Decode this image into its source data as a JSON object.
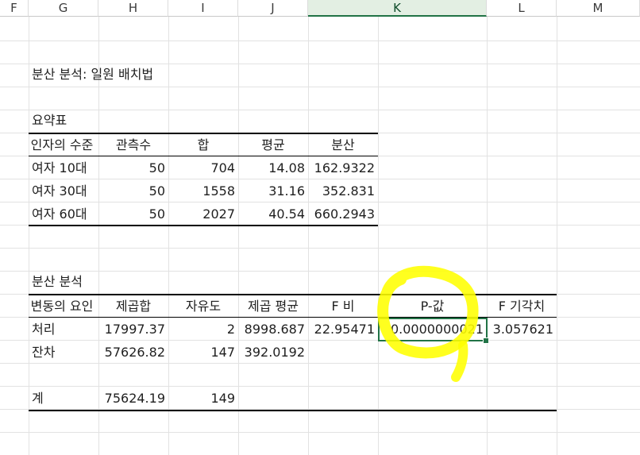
{
  "columns": [
    "F",
    "G",
    "H",
    "I",
    "J",
    "K",
    "L",
    "M"
  ],
  "selected_column": "K",
  "title": "분산 분석: 일원 배치법",
  "summary": {
    "label": "요약표",
    "headers": [
      "인자의 수준",
      "관측수",
      "합",
      "평균",
      "분산"
    ],
    "rows": [
      [
        "여자 10대",
        "50",
        "704",
        "14.08",
        "162.9322"
      ],
      [
        "여자 30대",
        "50",
        "1558",
        "31.16",
        "352.831"
      ],
      [
        "여자 60대",
        "50",
        "2027",
        "40.54",
        "660.2943"
      ]
    ]
  },
  "anova": {
    "label": "분산 분석",
    "headers": [
      "변동의 요인",
      "제곱합",
      "자유도",
      "제곱 평균",
      "F 비",
      "P-값",
      "F 기각치"
    ],
    "rows": [
      [
        "처리",
        "17997.37",
        "2",
        "8998.687",
        "22.95471",
        "0.0000000021",
        "3.057621"
      ],
      [
        "잔차",
        "57626.82",
        "147",
        "392.0192",
        "",
        "",
        ""
      ],
      [
        "",
        "",
        "",
        "",
        "",
        "",
        ""
      ],
      [
        "계",
        "75624.19",
        "149",
        "",
        "",
        "",
        ""
      ]
    ]
  },
  "highlight_color": "#ffff00",
  "selection_color": "#217346"
}
